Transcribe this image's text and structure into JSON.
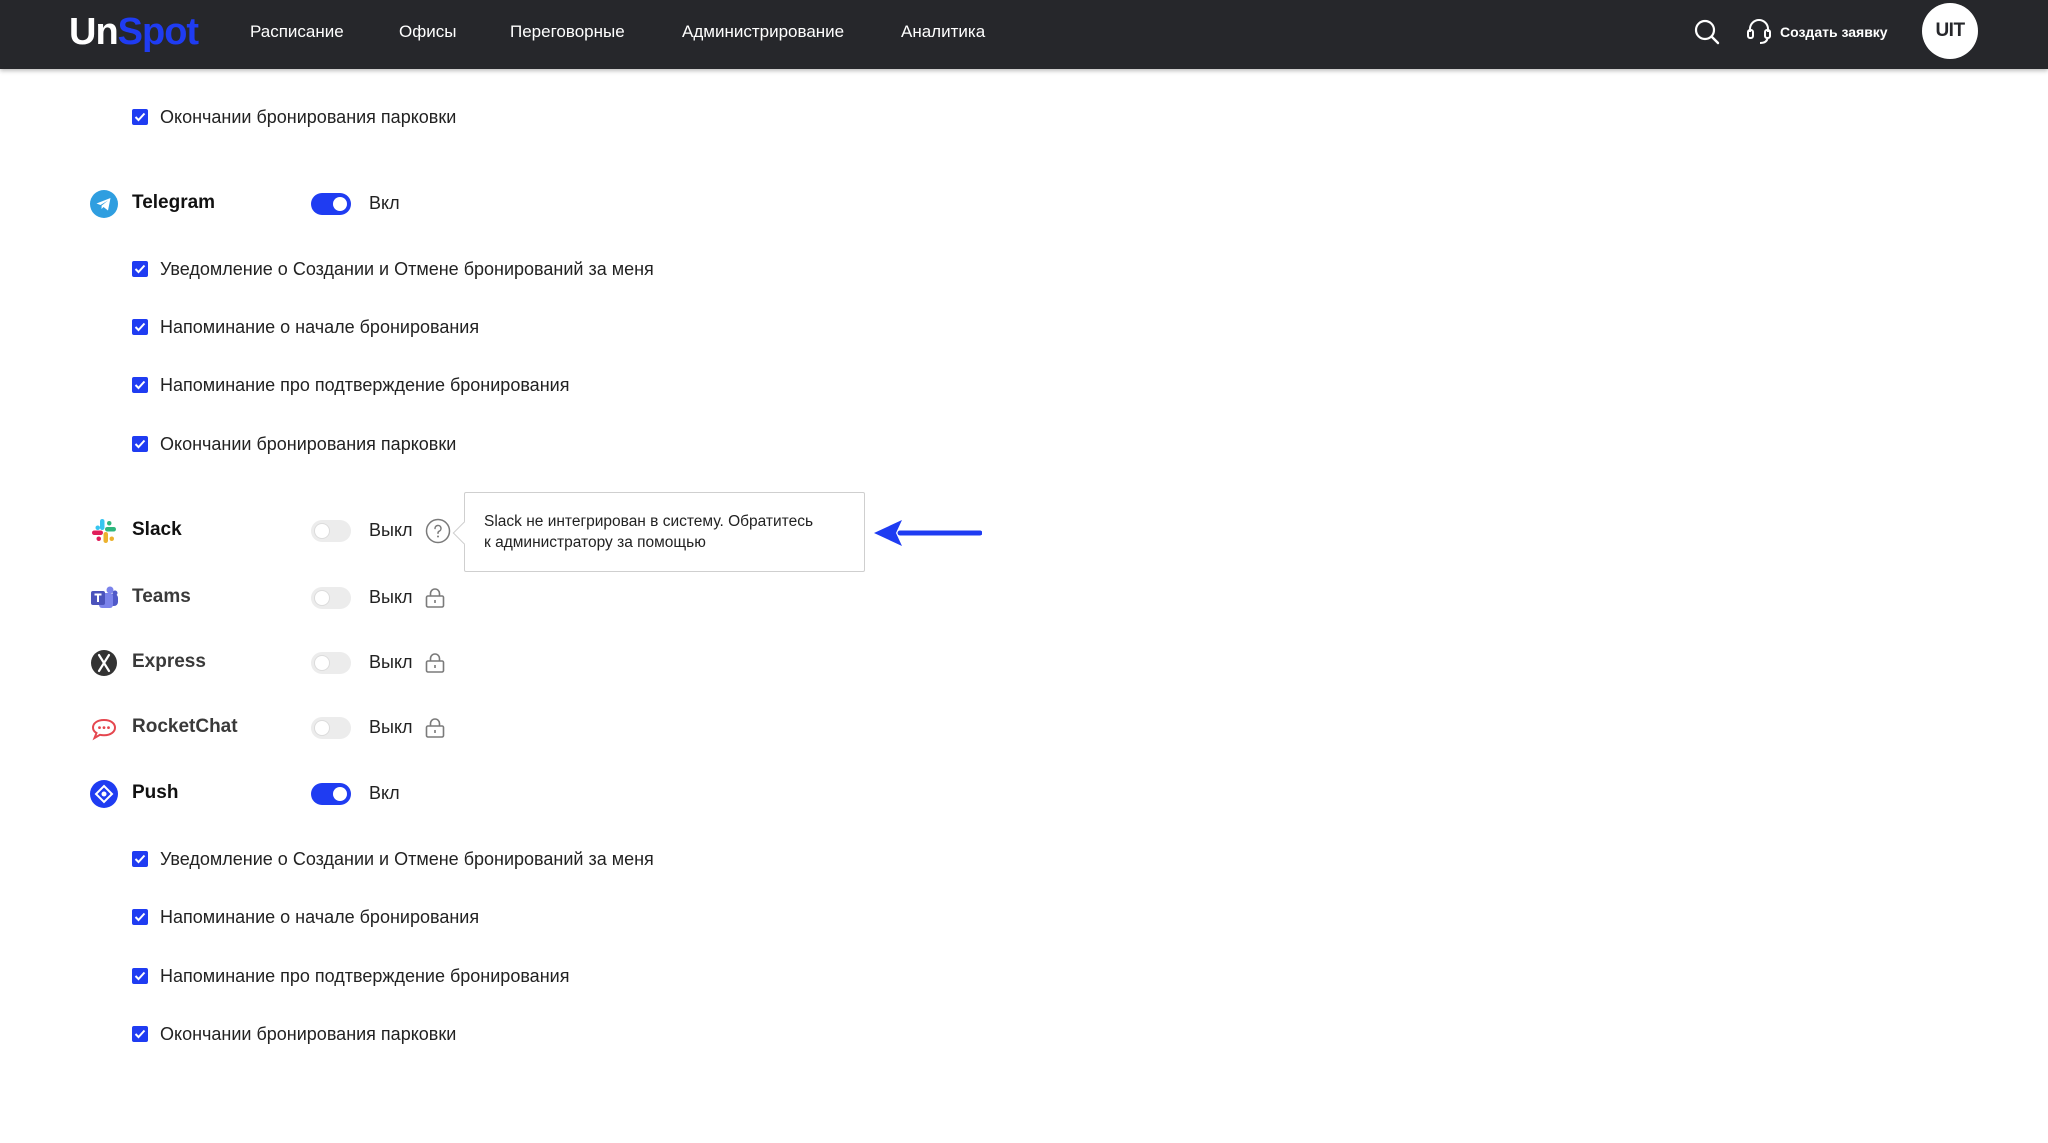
{
  "header": {
    "logo_un": "Un",
    "logo_spot": "Spot",
    "nav": [
      "Расписание",
      "Офисы",
      "Переговорные",
      "Администрирование",
      "Аналитика"
    ],
    "support_label": "Создать заявку",
    "avatar_text": "UIT",
    "icons": {
      "search": "search-icon",
      "support": "headset-icon"
    }
  },
  "top_partial": {
    "items": [
      "Окончании бронирования парковки"
    ]
  },
  "channels": {
    "telegram": {
      "name": "Telegram",
      "state": "Вкл",
      "enabled": true,
      "icon": "telegram-icon",
      "items": [
        "Уведомление о Создании и Отмене бронирований за меня",
        "Напоминание о начале бронирования",
        "Напоминание про подтверждение бронирования",
        "Окончании бронирования парковки"
      ]
    },
    "slack": {
      "name": "Slack",
      "state": "Выкл",
      "enabled": false,
      "icon": "slack-icon"
    },
    "teams": {
      "name": "Teams",
      "state": "Выкл",
      "enabled": false,
      "icon": "teams-icon"
    },
    "express": {
      "name": "Express",
      "state": "Выкл",
      "enabled": false,
      "icon": "express-icon"
    },
    "rocketchat": {
      "name": "RocketChat",
      "state": "Выкл",
      "enabled": false,
      "icon": "rocketchat-icon"
    },
    "push": {
      "name": "Push",
      "state": "Вкл",
      "enabled": true,
      "icon": "push-icon",
      "items": [
        "Уведомление о Создании и Отмене бронирований за меня",
        "Напоминание о начале бронирования",
        "Напоминание про подтверждение бронирования",
        "Окончании бронирования парковки"
      ]
    }
  },
  "tooltip": {
    "line1": "Slack не интегрирован в систему. Обратитесь",
    "line2": "к администратору за помощью"
  },
  "colors": {
    "accent": "#1f3cf2",
    "header_bg": "#26272b",
    "toggle_off": "#ececec"
  }
}
